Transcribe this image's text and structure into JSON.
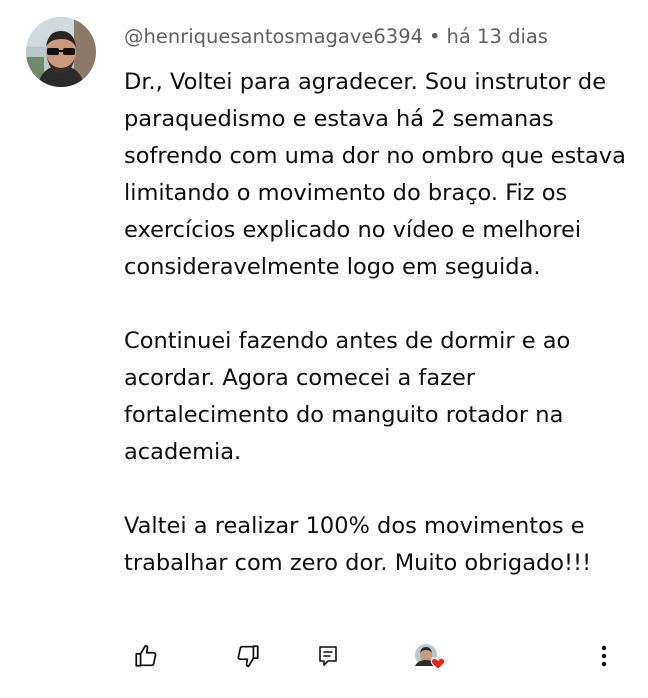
{
  "comment": {
    "author": "@henriquesantosmagave6394",
    "separator": "•",
    "time": "há 13 dias",
    "paragraphs": [
      "Dr., Voltei para agradecer. Sou instrutor de paraquedismo e estava há 2 semanas sofrendo com uma dor no ombro que estava limitando o movimento do braço. Fiz os exercícios explicado no vídeo e melhorei consideravelmente logo em seguida.",
      "Continuei fazendo antes de dormir e ao acordar. Agora comecei a fazer fortalecimento do manguito rotador na academia.",
      "Valtei a realizar 100% dos movimentos e trabalhar com zero dor. Muito obrigado!!!"
    ]
  },
  "actions": {
    "like_icon": "thumb-up-icon",
    "dislike_icon": "thumb-down-icon",
    "reply_icon": "reply-icon",
    "creator_heart_icon": "creator-heart-icon",
    "more_icon": "more-vertical-icon"
  },
  "colors": {
    "text": "#0f0f0f",
    "meta": "#606060",
    "heart": "#e62117"
  }
}
